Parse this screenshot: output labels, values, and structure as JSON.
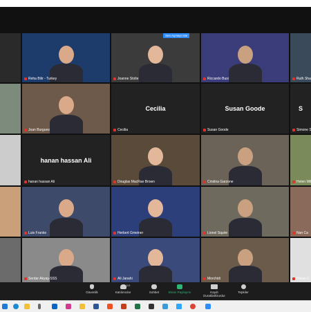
{
  "screen_share_button": "Sen Açmayı iste",
  "tiles": [
    {
      "name": "",
      "big": ""
    },
    {
      "name": "Reha Bilir - Turkey",
      "big": ""
    },
    {
      "name": "Joanne Stolte",
      "big": ""
    },
    {
      "name": "Riccardo Busi",
      "big": ""
    },
    {
      "name": "Ruth Sha",
      "big": ""
    },
    {
      "name": "",
      "big": ""
    },
    {
      "name": "Joan Burgues",
      "big": ""
    },
    {
      "name": "Cecilia",
      "big": "Cecilia"
    },
    {
      "name": "Susan Goode",
      "big": "Susan Goode"
    },
    {
      "name": "Simone S",
      "big": "S"
    },
    {
      "name": "",
      "big": ""
    },
    {
      "name": "hanan hassan Ali",
      "big": "hanan hassan Ali"
    },
    {
      "name": "Douglas MacRae Brown",
      "big": ""
    },
    {
      "name": "Cristina Garzone",
      "big": ""
    },
    {
      "name": "Helen Wilso",
      "big": ""
    },
    {
      "name": "",
      "big": ""
    },
    {
      "name": "Luis Franke",
      "big": ""
    },
    {
      "name": "Herbert Gmeiner",
      "big": ""
    },
    {
      "name": "Lionel Squire",
      "big": ""
    },
    {
      "name": "Nan Ca",
      "big": ""
    },
    {
      "name": "",
      "big": ""
    },
    {
      "name": "Serdar Akyaş-SSS",
      "big": ""
    },
    {
      "name": "Ali Janahi",
      "big": ""
    },
    {
      "name": "Morchidi",
      "big": ""
    },
    {
      "name": "Kleian C",
      "big": ""
    }
  ],
  "toolbar": {
    "security": "Güvenlik",
    "participants": "Katılımcılar",
    "participants_count": "119",
    "chat": "Sohbet",
    "share": "Ekran Paylaşımı",
    "record": "Kaydı Duraklat/Durdur",
    "reactions": "Tepkiler"
  }
}
